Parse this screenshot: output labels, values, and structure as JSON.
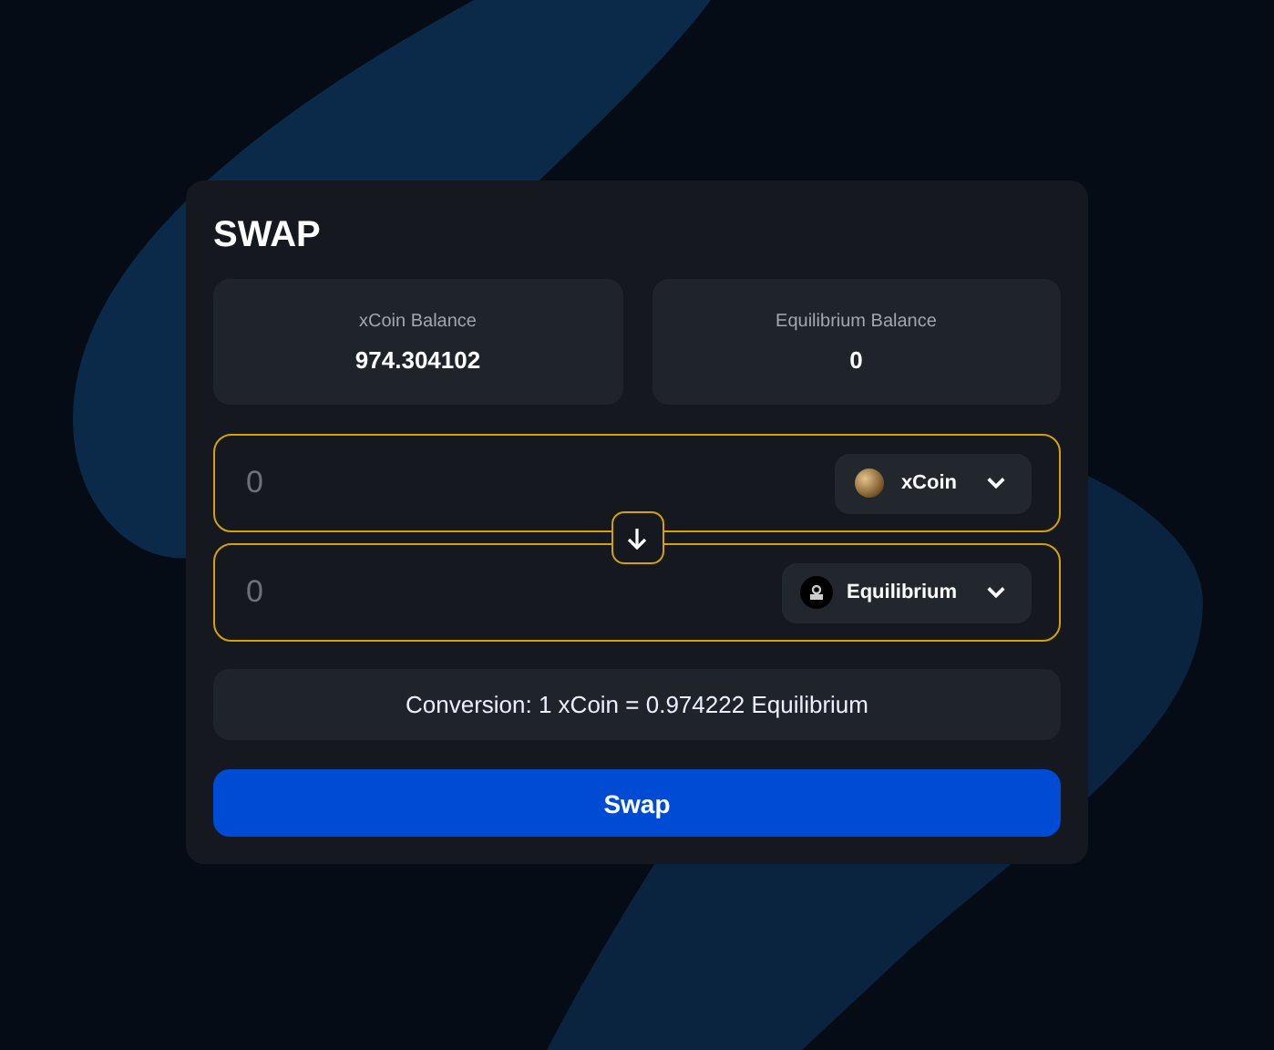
{
  "title": "SWAP",
  "balances": [
    {
      "label": "xCoin Balance",
      "value": "974.304102"
    },
    {
      "label": "Equilibrium Balance",
      "value": "0"
    }
  ],
  "inputs": [
    {
      "placeholder": "0",
      "token": "xCoin"
    },
    {
      "placeholder": "0",
      "token": "Equilibrium"
    }
  ],
  "conversion": "Conversion: 1 xCoin = 0.974222 Equilibrium",
  "button": "Swap"
}
